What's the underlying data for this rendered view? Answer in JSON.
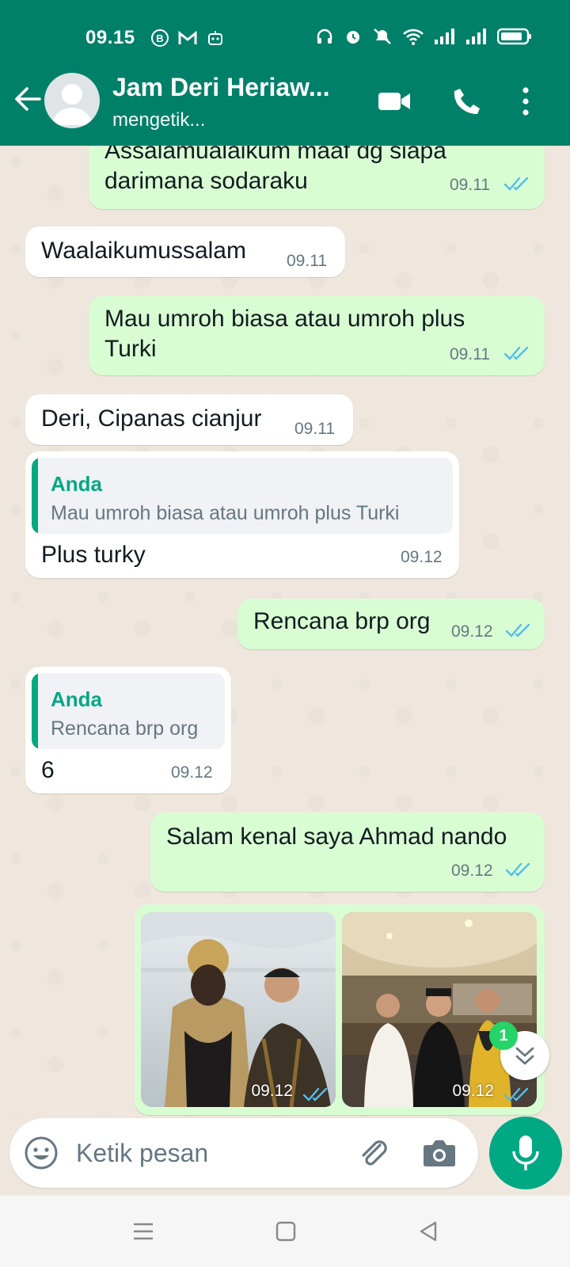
{
  "status_bar": {
    "time": "09.15"
  },
  "header": {
    "contact_name": "Jam Deri Heriaw...",
    "contact_status": "mengetik..."
  },
  "messages": [
    {
      "direction": "out",
      "text_lines": [
        "Assalamualaikum maaf dg siapa",
        "darimana sodaraku"
      ],
      "time": "09.11",
      "read": true
    },
    {
      "direction": "in",
      "text": "Waalaikumussalam",
      "time": "09.11"
    },
    {
      "direction": "out",
      "text_lines": [
        "Mau umroh biasa atau umroh plus",
        "Turki"
      ],
      "time": "09.11",
      "read": true
    },
    {
      "direction": "in",
      "text": "Deri, Cipanas cianjur",
      "time": "09.11"
    },
    {
      "direction": "in",
      "quote_name": "Anda",
      "quote_text": "Mau umroh biasa atau umroh plus Turki",
      "text": "Plus turky",
      "time": "09.12"
    },
    {
      "direction": "out",
      "text": "Rencana brp org",
      "time": "09.12",
      "read": true
    },
    {
      "direction": "in",
      "quote_name": "Anda",
      "quote_text": "Rencana brp org",
      "text": "6",
      "time": "09.12"
    },
    {
      "direction": "out",
      "text": "Salam kenal saya Ahmad nando",
      "time": "09.12",
      "read": true
    },
    {
      "direction": "out",
      "type": "photos",
      "photo_times": [
        "09.12",
        "09.12"
      ],
      "read": true
    }
  ],
  "scroll_to_bottom": {
    "unread_count": "1"
  },
  "composer": {
    "placeholder": "Ketik pesan"
  },
  "colors": {
    "header": "#008069",
    "outgoing_bubble": "#d9fdd3",
    "incoming_bubble": "#ffffff",
    "read_ticks": "#53bdeb",
    "accent": "#00a884"
  }
}
